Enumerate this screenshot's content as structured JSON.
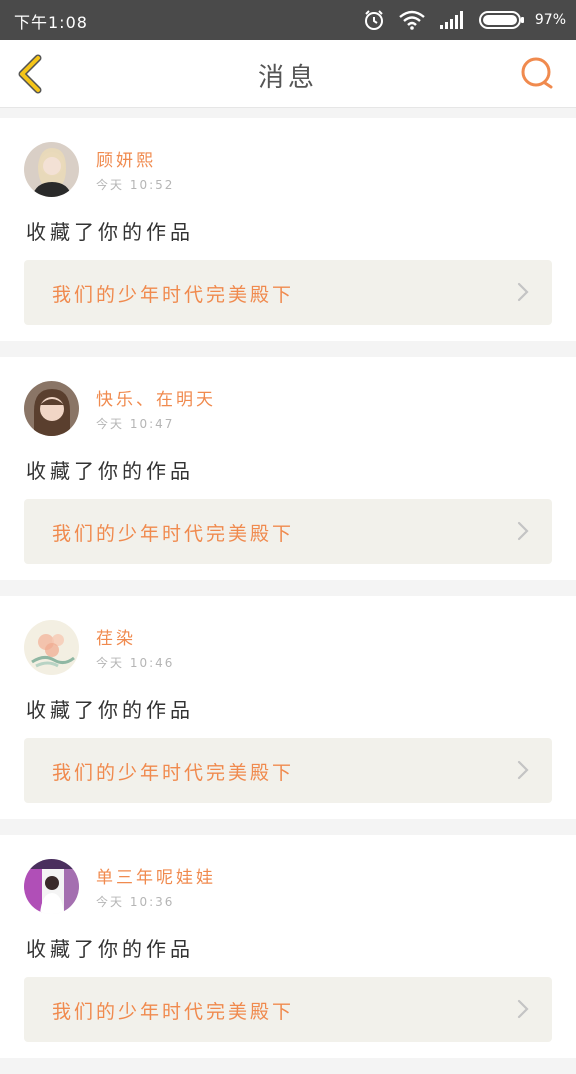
{
  "status_bar": {
    "time": "下午1:08",
    "battery": "97%",
    "icons": [
      "alarm-icon",
      "wifi-icon",
      "signal-icon",
      "battery-icon"
    ]
  },
  "header": {
    "title": "消息",
    "back_icon": "chevron-left-icon",
    "search_icon": "search-icon"
  },
  "colors": {
    "accent": "#f08a4e",
    "back_icon": "#f5c518",
    "card_link_bg": "#f2f1eb",
    "status_bar_bg": "#4a4a4a"
  },
  "messages": [
    {
      "username": "顾妍熙",
      "time": "今天 10:52",
      "action": "收藏了你的作品",
      "work_title": "我们的少年时代完美殿下",
      "avatar": "avatar-icon"
    },
    {
      "username": "快乐、在明天",
      "time": "今天 10:47",
      "action": "收藏了你的作品",
      "work_title": "我们的少年时代完美殿下",
      "avatar": "avatar-icon"
    },
    {
      "username": "荏染",
      "time": "今天 10:46",
      "action": "收藏了你的作品",
      "work_title": "我们的少年时代完美殿下",
      "avatar": "avatar-icon"
    },
    {
      "username": "单三年呢娃娃",
      "time": "今天 10:36",
      "action": "收藏了你的作品",
      "work_title": "我们的少年时代完美殿下",
      "avatar": "avatar-icon"
    }
  ]
}
